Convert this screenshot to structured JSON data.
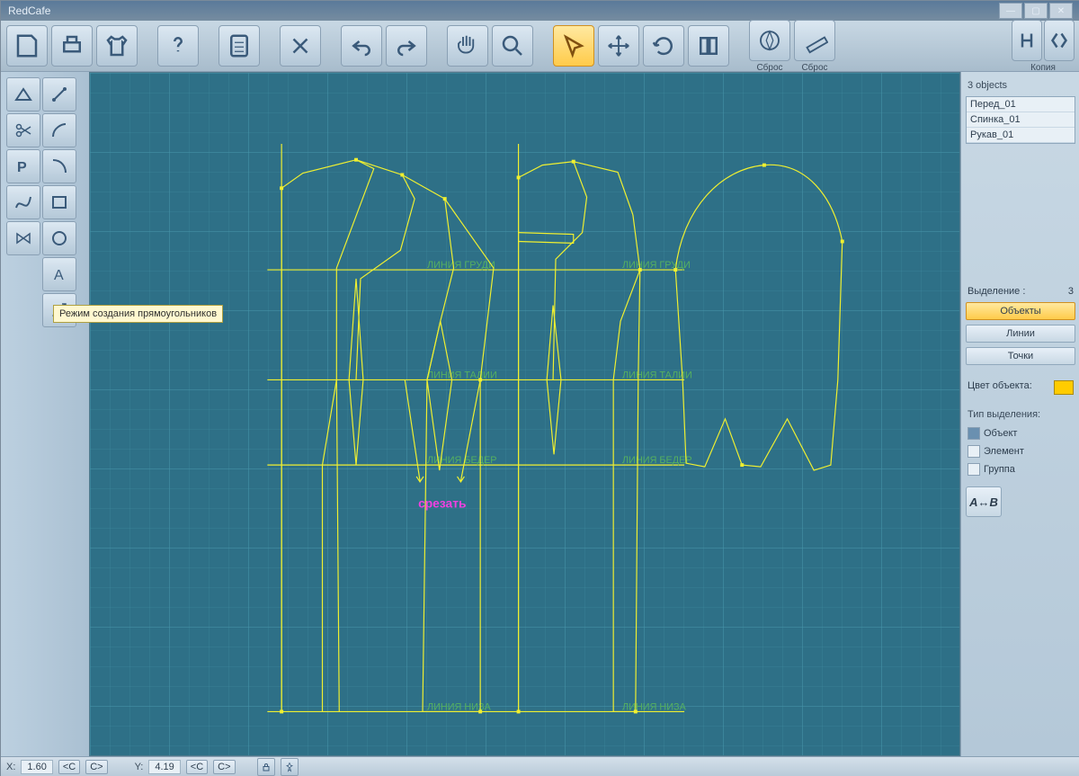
{
  "app_title": "RedCafe",
  "toolbar": {
    "reset1": "Сброс",
    "reset2": "Сброс",
    "copy": "Копия"
  },
  "tooltip": "Режим создания прямоугольников",
  "annotation": {
    "cut": "срезать"
  },
  "guides": {
    "chest": "ЛИНИЯ ГРУДИ",
    "waist": "ЛИНИЯ ТАЛИИ",
    "hip": "ЛИНИЯ БЕДЕР",
    "hem": "ЛИНИЯ НИЗА"
  },
  "right": {
    "count": "3 objects",
    "items": [
      "Перед_01",
      "Спинка_01",
      "Рукав_01"
    ],
    "sel_label": "Выделение :",
    "sel_count": "3",
    "btn_obj": "Объекты",
    "btn_lines": "Линии",
    "btn_pts": "Точки",
    "color_label": "Цвет объекта:",
    "seltype_label": "Тип выделения:",
    "chk_obj": "Объект",
    "chk_elem": "Элемент",
    "chk_grp": "Группа",
    "ab": "A↔B"
  },
  "status": {
    "xlabel": "X:",
    "x": "1.60",
    "ylabel": "Y:",
    "y": "4.19",
    "lc": "<C",
    "rc": "C>",
    "lc2": "<C",
    "rc2": "C>"
  }
}
